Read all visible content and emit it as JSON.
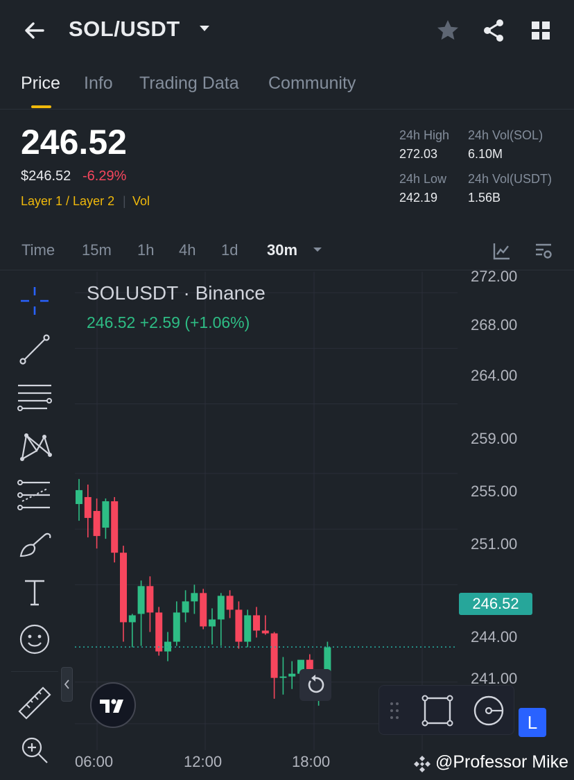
{
  "header": {
    "pair": "SOL/USDT",
    "icons": {
      "back": "back-arrow-icon",
      "caret": "caret-down-icon",
      "star": "star-icon",
      "share": "share-icon",
      "grid": "grid-icon"
    }
  },
  "tabs": [
    {
      "label": "Price",
      "active": true
    },
    {
      "label": "Info",
      "active": false
    },
    {
      "label": "Trading Data",
      "active": false
    },
    {
      "label": "Community",
      "active": false
    }
  ],
  "ticker": {
    "last": "246.52",
    "usd": "$246.52",
    "change": "-6.29%",
    "tag1": "Layer 1 / Layer 2",
    "tag2": "Vol",
    "stats": {
      "high_label": "24h High",
      "high": "272.03",
      "low_label": "24h Low",
      "low": "242.19",
      "vol_base_label": "24h Vol(SOL)",
      "vol_base": "6.10M",
      "vol_quote_label": "24h Vol(USDT)",
      "vol_quote": "1.56B"
    }
  },
  "intervals": [
    {
      "label": "Time",
      "active": false
    },
    {
      "label": "15m",
      "active": false
    },
    {
      "label": "1h",
      "active": false
    },
    {
      "label": "4h",
      "active": false
    },
    {
      "label": "1d",
      "active": false
    },
    {
      "label": "30m",
      "active": true
    }
  ],
  "chart_legend": {
    "title": "SOLUSDT · Binance",
    "values": "246.52  +2.59 (+1.06%)"
  },
  "colors": {
    "up": "#2ebd85",
    "down": "#f6465d",
    "accent": "#f0b90b",
    "last_price": "#26a69a"
  },
  "chart_data": {
    "type": "candlestick",
    "y_ticks": [
      "272.00",
      "268.00",
      "264.00",
      "259.00",
      "255.00",
      "251.00",
      "244.00",
      "241.00"
    ],
    "last_price_label": "246.52",
    "x_ticks": [
      "06:00",
      "12:00",
      "18:00"
    ],
    "candles": [
      [
        256.8,
        258.6,
        255.6,
        257.8
      ],
      [
        257.3,
        258.2,
        254.4,
        255.8
      ],
      [
        256.3,
        257.2,
        253.6,
        254.5
      ],
      [
        255.1,
        257.2,
        254.3,
        257.0
      ],
      [
        257.0,
        257.3,
        252.6,
        253.3
      ],
      [
        253.3,
        253.8,
        246.9,
        248.3
      ],
      [
        248.3,
        248.9,
        246.5,
        248.8
      ],
      [
        248.9,
        251.3,
        246.6,
        250.9
      ],
      [
        250.9,
        251.6,
        247.6,
        249.0
      ],
      [
        249.0,
        249.4,
        245.9,
        246.2
      ],
      [
        246.2,
        247.6,
        245.5,
        246.9
      ],
      [
        246.9,
        249.8,
        246.6,
        249.0
      ],
      [
        249.0,
        250.6,
        248.3,
        249.8
      ],
      [
        249.8,
        251.0,
        248.9,
        250.4
      ],
      [
        250.4,
        250.7,
        247.8,
        248.0
      ],
      [
        248.0,
        249.3,
        246.7,
        248.5
      ],
      [
        248.5,
        250.4,
        246.6,
        250.2
      ],
      [
        250.2,
        250.6,
        248.6,
        249.2
      ],
      [
        249.2,
        249.8,
        246.4,
        246.9
      ],
      [
        246.9,
        249.2,
        246.5,
        248.8
      ],
      [
        248.8,
        249.4,
        247.2,
        247.7
      ],
      [
        247.7,
        248.8,
        247.4,
        247.5
      ],
      [
        247.5,
        247.6,
        242.8,
        244.3
      ],
      [
        244.3,
        245.8,
        243.1,
        244.4
      ],
      [
        244.4,
        245.5,
        243.5,
        244.6
      ],
      [
        244.6,
        245.4,
        243.2,
        245.6
      ],
      [
        245.6,
        246.0,
        242.7,
        243.4
      ],
      [
        243.4,
        244.4,
        242.3,
        244.3
      ],
      [
        244.3,
        246.9,
        244.1,
        246.5
      ]
    ],
    "ylim": [
      239.1,
      273.5
    ],
    "gridlines": true
  },
  "toolbar": {
    "tools": [
      "crosshair-icon",
      "trendline-icon",
      "horizontal-lines-icon",
      "pattern-icon",
      "fib-icon",
      "brush-icon",
      "text-icon",
      "emoji-icon",
      "ruler-icon",
      "zoom-icon"
    ]
  },
  "float_toolbar": {
    "badge": "L"
  },
  "watermark": "@Professor Mike"
}
